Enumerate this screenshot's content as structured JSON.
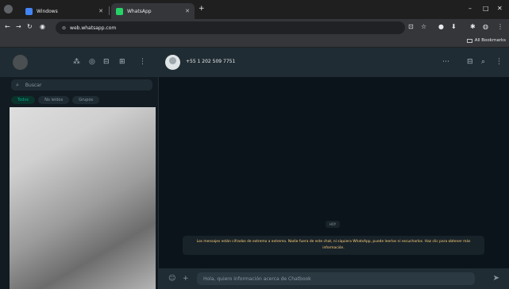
{
  "browser": {
    "tabs": [
      {
        "title": "Windows",
        "favicon_color": "#4285f4"
      },
      {
        "title": "WhatsApp",
        "favicon_color": "#25d366"
      }
    ],
    "new_tab": "+",
    "url": "web.whatsapp.com",
    "bookmarks_label": "All Bookmarks"
  },
  "whatsapp": {
    "search_placeholder": "Buscar",
    "filters": [
      "Todos",
      "No leídos",
      "Grupos"
    ],
    "contact_name": "+55 1 202 509 7751",
    "day_badge": "HOY",
    "encryption_notice": "Los mensajes están cifrados de extremo a extremo. Nadie fuera de este chat, ni siquiera WhatsApp, puede leerlos ni escucharlos. Haz clic para obtener más información.",
    "composer_placeholder": "Hola, quiero información acerca de Chatbook"
  },
  "colors": {
    "accent": "#00a884",
    "notice_text": "#ffd279",
    "chat_background": "#0b141a"
  }
}
